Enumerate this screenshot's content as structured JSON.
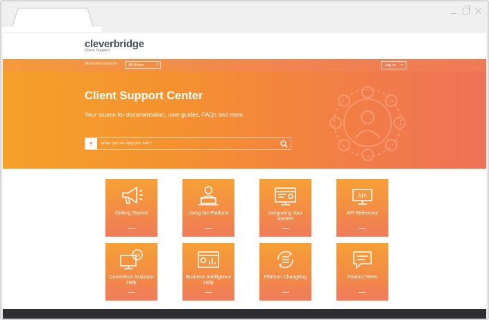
{
  "brand": {
    "logo_text": "cleverbridge",
    "logo_subtext": "Client Support"
  },
  "filter": {
    "label": "Show resources for",
    "selected": "All Users",
    "login_label": "Log In"
  },
  "hero": {
    "title": "Client Support Center",
    "subtitle": "Your source for documentation, user guides, FAQs and more",
    "search_placeholder": "What can we help you find?"
  },
  "tiles": [
    {
      "label": "Getting Started",
      "icon": "megaphone-icon"
    },
    {
      "label": "Using the Platform",
      "icon": "user-laptop-icon"
    },
    {
      "label": "Integrating Your System",
      "icon": "browser-window-icon"
    },
    {
      "label": "API Reference",
      "icon": "api-icon"
    },
    {
      "label": "Commerce Assistant Help",
      "icon": "monitor-ca-icon"
    },
    {
      "label": "Business Intelligence Help",
      "icon": "analytics-dashboard-icon"
    },
    {
      "label": "Platform Changelog",
      "icon": "changelog-list-icon"
    },
    {
      "label": "Product News",
      "icon": "chat-bubble-icon"
    }
  ],
  "colors": {
    "accent_orange": "#f49a3c",
    "accent_coral": "#ef7258",
    "footer_dark": "#2f2f33"
  }
}
